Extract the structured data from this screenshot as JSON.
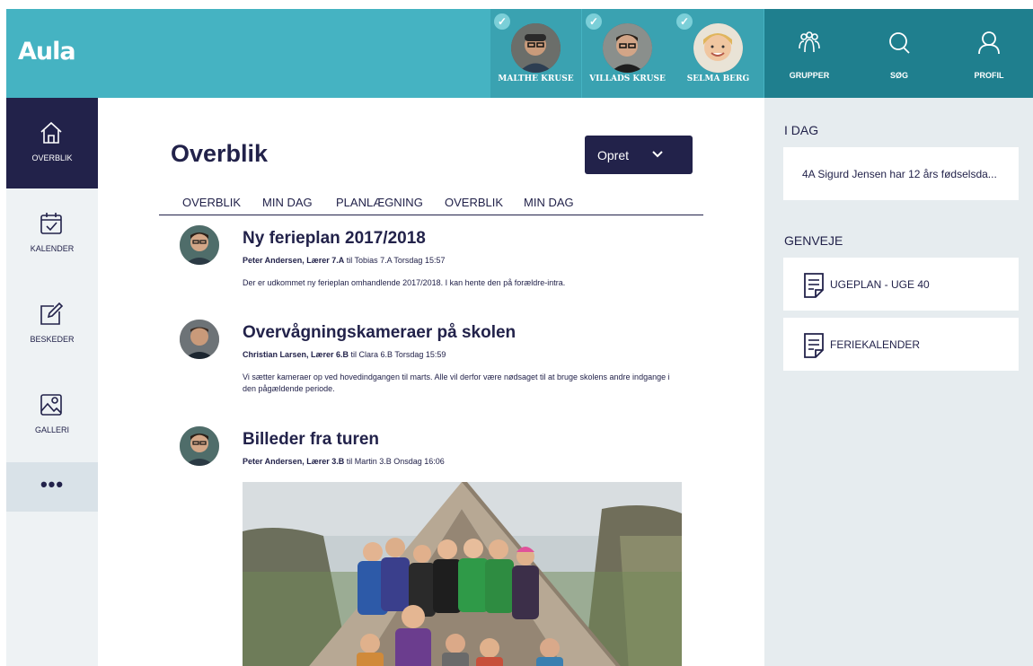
{
  "app": {
    "logo": "Aula"
  },
  "children": [
    {
      "name": "MALTHE KRUSE",
      "checked": true
    },
    {
      "name": "VILLADS KRUSE",
      "checked": true
    },
    {
      "name": "SELMA BERG",
      "checked": true
    }
  ],
  "topnav": [
    {
      "label": "GRUPPER",
      "icon": "groups-icon"
    },
    {
      "label": "SØG",
      "icon": "search-icon"
    },
    {
      "label": "PROFIL",
      "icon": "profile-icon"
    }
  ],
  "sidebar": {
    "items": [
      {
        "label": "OVERBLIK",
        "icon": "home-icon",
        "active": true
      },
      {
        "label": "KALENDER",
        "icon": "calendar-icon",
        "active": false
      },
      {
        "label": "BESKEDER",
        "icon": "compose-icon",
        "active": false
      },
      {
        "label": "GALLERI",
        "icon": "gallery-icon",
        "active": false
      }
    ],
    "more": "•••"
  },
  "main": {
    "title": "Overblik",
    "create_button": "Opret",
    "tabs": [
      "OVERBLIK",
      "MIN DAG",
      "PLANLÆGNING",
      "OVERBLIK",
      "MIN DAG"
    ],
    "posts": [
      {
        "title": "Ny ferieplan 2017/2018",
        "author": "Peter Andersen, Lærer 7.A",
        "meta_rest": " til Tobias 7.A Torsdag 15:57",
        "body": "Der er udkommet ny ferieplan omhandlende 2017/2018. I kan hente den på forældre-intra."
      },
      {
        "title": "Overvågningskameraer på skolen",
        "author": "Christian Larsen, Lærer 6.B",
        "meta_rest": " til Clara 6.B Torsdag 15:59",
        "body": "Vi sætter kameraer op ved hovedindgangen til marts. Alle vil derfor være nødsaget til at bruge skolens andre indgange i den pågældende periode."
      },
      {
        "title": "Billeder fra turen",
        "author": "Peter Andersen, Lærer 3.B",
        "meta_rest": " til Martin 3.B Onsdag 16:06",
        "body": ""
      }
    ]
  },
  "right": {
    "today_heading": "I DAG",
    "today_item": "4A Sigurd Jensen har 12 års fødselsda...",
    "shortcuts_heading": "GENVEJE",
    "shortcuts": [
      "UGEPLAN - UGE 40",
      "FERIEKALENDER"
    ]
  },
  "colors": {
    "header": "#45b3c2",
    "child_bg": "#3aa2b1",
    "navbar": "#1f7f8e",
    "navy": "#22224a",
    "sidebar": "#eef2f4",
    "right_panel": "#e6ecef"
  }
}
